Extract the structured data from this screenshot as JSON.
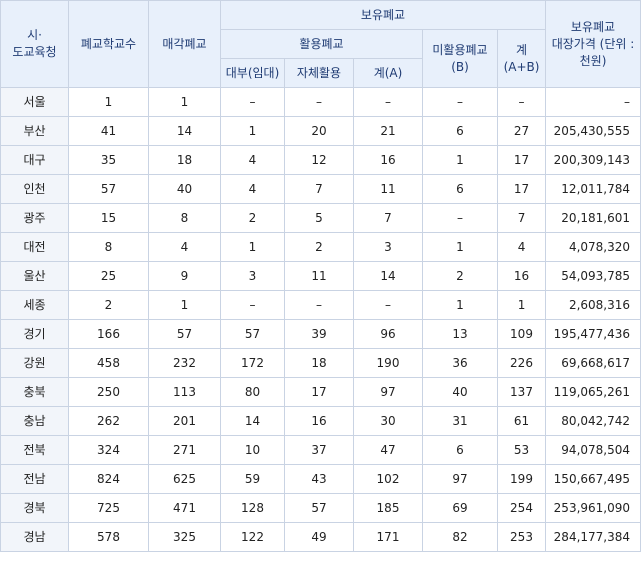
{
  "header": {
    "region": "시·\n도교육청",
    "closed_schools": "폐교학교수",
    "sold": "매각폐교",
    "held": "보유폐교",
    "utilized": "활용폐교",
    "lease": "대부(임대)",
    "self_use": "자체활용",
    "subtotal_a": "계(A)",
    "unused_b": "미활용폐교\n(B)",
    "total_ab": "계\n(A+B)",
    "book_value": "보유폐교\n대장가격 (단위 :\n천원)"
  },
  "rows": [
    {
      "region": "서울",
      "closed": "1",
      "sold": "1",
      "lease": "–",
      "self": "–",
      "a": "–",
      "b": "–",
      "ab": "–",
      "value": "–"
    },
    {
      "region": "부산",
      "closed": "41",
      "sold": "14",
      "lease": "1",
      "self": "20",
      "a": "21",
      "b": "6",
      "ab": "27",
      "value": "205,430,555"
    },
    {
      "region": "대구",
      "closed": "35",
      "sold": "18",
      "lease": "4",
      "self": "12",
      "a": "16",
      "b": "1",
      "ab": "17",
      "value": "200,309,143"
    },
    {
      "region": "인천",
      "closed": "57",
      "sold": "40",
      "lease": "4",
      "self": "7",
      "a": "11",
      "b": "6",
      "ab": "17",
      "value": "12,011,784"
    },
    {
      "region": "광주",
      "closed": "15",
      "sold": "8",
      "lease": "2",
      "self": "5",
      "a": "7",
      "b": "–",
      "ab": "7",
      "value": "20,181,601"
    },
    {
      "region": "대전",
      "closed": "8",
      "sold": "4",
      "lease": "1",
      "self": "2",
      "a": "3",
      "b": "1",
      "ab": "4",
      "value": "4,078,320"
    },
    {
      "region": "울산",
      "closed": "25",
      "sold": "9",
      "lease": "3",
      "self": "11",
      "a": "14",
      "b": "2",
      "ab": "16",
      "value": "54,093,785"
    },
    {
      "region": "세종",
      "closed": "2",
      "sold": "1",
      "lease": "–",
      "self": "–",
      "a": "–",
      "b": "1",
      "ab": "1",
      "value": "2,608,316"
    },
    {
      "region": "경기",
      "closed": "166",
      "sold": "57",
      "lease": "57",
      "self": "39",
      "a": "96",
      "b": "13",
      "ab": "109",
      "value": "195,477,436"
    },
    {
      "region": "강원",
      "closed": "458",
      "sold": "232",
      "lease": "172",
      "self": "18",
      "a": "190",
      "b": "36",
      "ab": "226",
      "value": "69,668,617"
    },
    {
      "region": "충북",
      "closed": "250",
      "sold": "113",
      "lease": "80",
      "self": "17",
      "a": "97",
      "b": "40",
      "ab": "137",
      "value": "119,065,261"
    },
    {
      "region": "충남",
      "closed": "262",
      "sold": "201",
      "lease": "14",
      "self": "16",
      "a": "30",
      "b": "31",
      "ab": "61",
      "value": "80,042,742"
    },
    {
      "region": "전북",
      "closed": "324",
      "sold": "271",
      "lease": "10",
      "self": "37",
      "a": "47",
      "b": "6",
      "ab": "53",
      "value": "94,078,504"
    },
    {
      "region": "전남",
      "closed": "824",
      "sold": "625",
      "lease": "59",
      "self": "43",
      "a": "102",
      "b": "97",
      "ab": "199",
      "value": "150,667,495"
    },
    {
      "region": "경북",
      "closed": "725",
      "sold": "471",
      "lease": "128",
      "self": "57",
      "a": "185",
      "b": "69",
      "ab": "254",
      "value": "253,961,090"
    },
    {
      "region": "경남",
      "closed": "578",
      "sold": "325",
      "lease": "122",
      "self": "49",
      "a": "171",
      "b": "82",
      "ab": "253",
      "value": "284,177,384"
    }
  ]
}
